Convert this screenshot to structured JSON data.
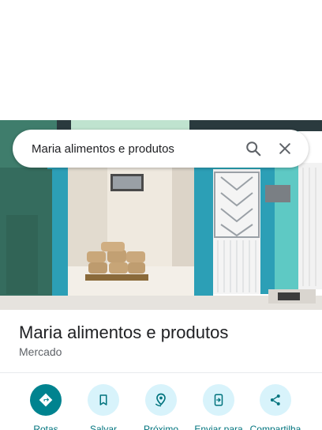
{
  "search": {
    "query": "Maria alimentos e produtos",
    "search_icon": "search-icon",
    "close_icon": "close-icon"
  },
  "place": {
    "name": "Maria alimentos e produtos",
    "category": "Mercado"
  },
  "actions": [
    {
      "label": "Rotas",
      "icon": "directions-icon",
      "primary": true
    },
    {
      "label": "Salvar",
      "icon": "bookmark-icon",
      "primary": false
    },
    {
      "label": "Próximo",
      "icon": "nearby-icon",
      "primary": false
    },
    {
      "label": "Enviar para",
      "icon": "send-to-phone-icon",
      "primary": false
    },
    {
      "label": "Compartilha",
      "icon": "share-icon",
      "primary": false
    }
  ],
  "colors": {
    "accent": "#00838f",
    "action_bg": "#d8f3fb",
    "action_label": "#00737d"
  }
}
